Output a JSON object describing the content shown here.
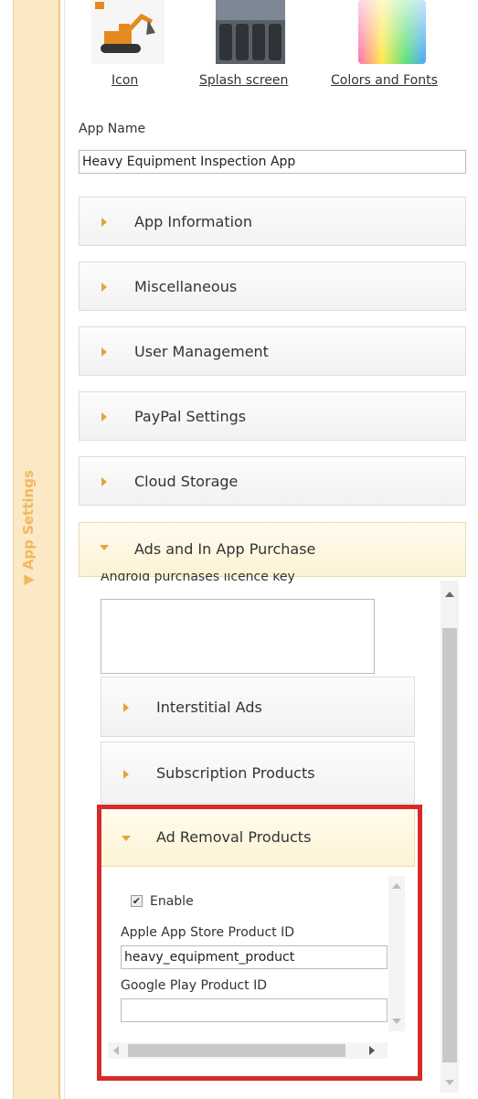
{
  "sidebar": {
    "tab_label": "▼ App Settings"
  },
  "assets": [
    {
      "name": "icon",
      "label": "Icon"
    },
    {
      "name": "splash",
      "label": "Splash screen"
    },
    {
      "name": "colors",
      "label": "Colors and Fonts"
    }
  ],
  "app_name": {
    "label": "App Name",
    "value": "Heavy Equipment Inspection App"
  },
  "sections": [
    {
      "label": "App Information"
    },
    {
      "label": "Miscellaneous"
    },
    {
      "label": "User Management"
    },
    {
      "label": "PayPal Settings"
    },
    {
      "label": "Cloud Storage"
    },
    {
      "label": "Ads and In App Purchase"
    }
  ],
  "ads": {
    "licence_label": "Android purchases licence key",
    "licence_value": "",
    "subsections": [
      {
        "label": "Interstitial Ads"
      },
      {
        "label": "Subscription Products"
      },
      {
        "label": "Ad Removal Products"
      }
    ],
    "ad_removal": {
      "enable_label": "Enable",
      "enable_checked": true,
      "apple_label": "Apple App Store Product ID",
      "apple_value": "heavy_equipment_product",
      "google_label": "Google Play Product ID",
      "google_value": ""
    }
  },
  "colors": {
    "accent": "#f0b860",
    "highlight": "#d42b2b"
  }
}
